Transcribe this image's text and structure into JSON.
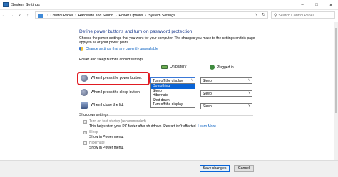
{
  "window": {
    "title": "System Settings",
    "icon": "control-panel-icon"
  },
  "address": {
    "crumbs": [
      "Control Panel",
      "Hardware and Sound",
      "Power Options",
      "System Settings"
    ],
    "search_placeholder": "Search Control Panel"
  },
  "page": {
    "title": "Define power buttons and turn on password protection",
    "description": "Choose the power settings that you want for your computer. The changes you make to the settings on this page apply to all of your power plans.",
    "change_link": "Change settings that are currently unavailable"
  },
  "power_section": {
    "label": "Power and sleep buttons and lid settings",
    "col_battery": "On battery",
    "col_plugged": "Plugged in",
    "rows": [
      {
        "label": "When I press the power button:",
        "battery": "Turn off the display",
        "plugged": "Sleep"
      },
      {
        "label": "When I press the sleep button:",
        "battery": "",
        "plugged": "Sleep"
      },
      {
        "label": "When I close the lid:",
        "battery": "",
        "plugged": "Sleep"
      }
    ],
    "dropdown_options": [
      "Do nothing",
      "Sleep",
      "Hibernate",
      "Shut down",
      "Turn off the display"
    ],
    "dropdown_selected_index": 0
  },
  "shutdown_section": {
    "label": "Shutdown settings",
    "fast_startup_label": "Turn on fast startup (recommended)",
    "fast_startup_desc": "This helps start your PC faster after shutdown. Restart isn't affected.",
    "learn_more": "Learn More",
    "sleep_label": "Sleep",
    "sleep_desc": "Show in Power menu.",
    "hibernate_label": "Hibernate",
    "hibernate_desc": "Show in Power menu."
  },
  "footer": {
    "save_label": "Save changes",
    "cancel_label": "Cancel"
  },
  "colors": {
    "accent": "#0a64d6",
    "title": "#1e3d8f",
    "highlight": "#e01b22"
  }
}
